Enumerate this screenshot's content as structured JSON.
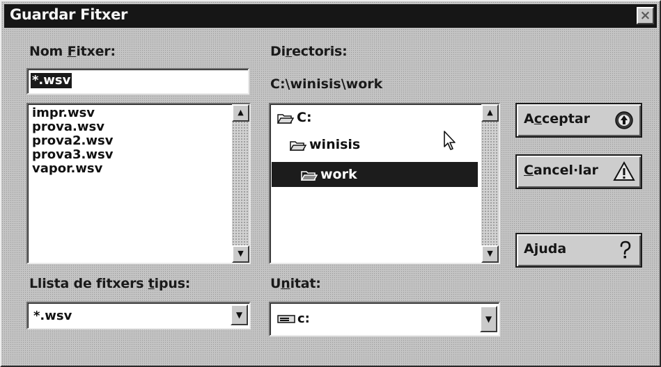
{
  "window": {
    "title": "Guardar Fitxer",
    "close_glyph": "×"
  },
  "filename": {
    "label_pre": "Nom ",
    "label_key": "F",
    "label_post": "itxer:",
    "value": "*.wsv",
    "files": [
      "impr.wsv",
      "prova.wsv",
      "prova2.wsv",
      "prova3.wsv",
      "vapor.wsv"
    ]
  },
  "directories": {
    "label_pre": "Di",
    "label_key": "r",
    "label_post": "ectoris:",
    "current_path": "C:\\winisis\\work",
    "tree": [
      "C:",
      "winisis",
      "work"
    ],
    "selected": "work"
  },
  "filetype": {
    "label_pre": "Llista de fitxers ",
    "label_key": "t",
    "label_post": "ipus:",
    "value": "*.wsv"
  },
  "drive": {
    "label_pre": "U",
    "label_key": "n",
    "label_post": "itat:",
    "value": "c:"
  },
  "buttons": {
    "accept": {
      "pre": "A",
      "key": "c",
      "post": "ceptar",
      "icon": "up-arrow-circle-icon"
    },
    "cancel": {
      "pre": "",
      "key": "C",
      "post": "ancel·lar",
      "icon": "warning-triangle-icon"
    },
    "help": {
      "pre": "A",
      "key": "j",
      "post": "uda",
      "icon": "question-mark-icon"
    }
  },
  "scroll_glyphs": {
    "up": "▲",
    "down": "▼"
  },
  "colors": {
    "titlebar": "#161616",
    "selection": "#1c1c1c",
    "face": "#c8c8c8"
  }
}
